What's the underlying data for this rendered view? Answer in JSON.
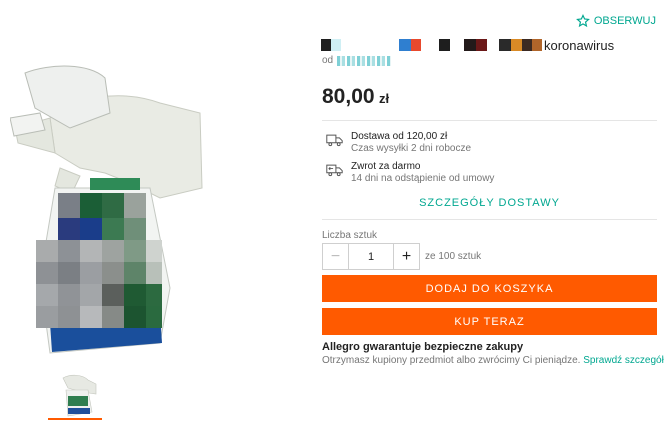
{
  "watch": {
    "label": "OBSERWUJ",
    "icon": "star-outline-icon",
    "color": "#00a790"
  },
  "product": {
    "title_text": "koronawirus",
    "seller_prefix": "od",
    "price_main": "80,00",
    "price_currency": "zł"
  },
  "delivery": {
    "main": "Dostawa od 120,00 zł",
    "sub": "Czas wysyłki 2 dni robocze",
    "icon": "truck-icon"
  },
  "returns": {
    "main": "Zwrot za darmo",
    "sub": "14 dni na odstąpienie od umowy",
    "icon": "return-truck-icon"
  },
  "details_link": "SZCZEGÓŁY DOSTAWY",
  "quantity": {
    "label": "Liczba sztuk",
    "value": "1",
    "minus": "−",
    "plus": "+",
    "max_text": "ze 100 sztuk"
  },
  "actions": {
    "add_to_cart": "DODAJ DO KOSZYKA",
    "buy_now": "KUP TERAZ",
    "accent": "#ff5a00"
  },
  "guarantee": {
    "title": "Allegro gwarantuje bezpieczne zakupy",
    "text": "Otrzymasz kupiony przedmiot albo zwrócimy Ci pieniądze.",
    "link": "Sprawdź szczegóły."
  }
}
